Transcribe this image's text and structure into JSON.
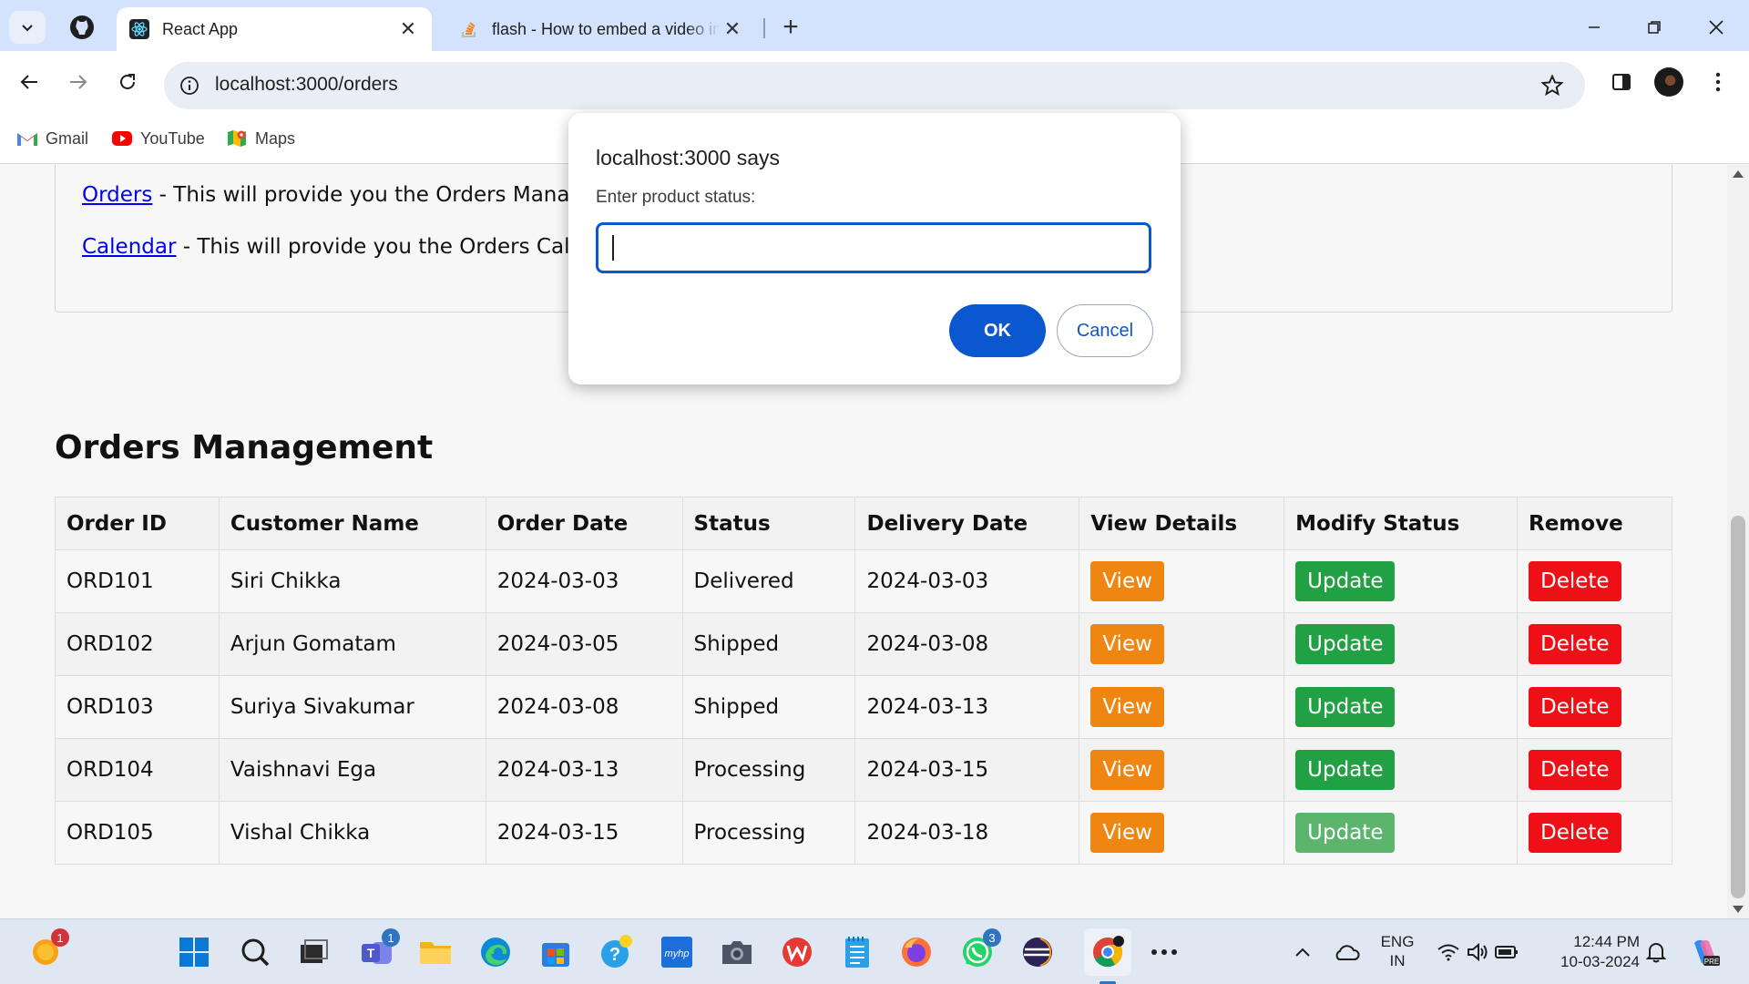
{
  "browser": {
    "tabs": [
      {
        "title": "React App",
        "active": true
      },
      {
        "title": "flash - How to embed a video in",
        "active": false
      }
    ],
    "url": "localhost:3000/orders",
    "bookmarks": [
      "Gmail",
      "YouTube",
      "Maps"
    ]
  },
  "page": {
    "links": [
      {
        "label": "Orders",
        "text": " - This will provide you the Orders Mana"
      },
      {
        "label": "Calendar",
        "text": " - This will provide you the Orders Cale"
      }
    ],
    "heading": "Orders Management",
    "table": {
      "headers": [
        "Order ID",
        "Customer Name",
        "Order Date",
        "Status",
        "Delivery Date",
        "View Details",
        "Modify Status",
        "Remove"
      ],
      "rows": [
        {
          "id": "ORD101",
          "customer": "Siri Chikka",
          "order_date": "2024-03-03",
          "status": "Delivered",
          "delivery_date": "2024-03-03"
        },
        {
          "id": "ORD102",
          "customer": "Arjun Gomatam",
          "order_date": "2024-03-05",
          "status": "Shipped",
          "delivery_date": "2024-03-08"
        },
        {
          "id": "ORD103",
          "customer": "Suriya Sivakumar",
          "order_date": "2024-03-08",
          "status": "Shipped",
          "delivery_date": "2024-03-13"
        },
        {
          "id": "ORD104",
          "customer": "Vaishnavi Ega",
          "order_date": "2024-03-13",
          "status": "Processing",
          "delivery_date": "2024-03-15"
        },
        {
          "id": "ORD105",
          "customer": "Vishal Chikka",
          "order_date": "2024-03-15",
          "status": "Processing",
          "delivery_date": "2024-03-18"
        }
      ],
      "view_label": "View",
      "update_label": "Update",
      "delete_label": "Delete"
    }
  },
  "dialog": {
    "title": "localhost:3000 says",
    "message": "Enter product status:",
    "input_value": "",
    "ok_label": "OK",
    "cancel_label": "Cancel"
  },
  "taskbar": {
    "badges": {
      "notification": "1",
      "teams": "1",
      "whatsapp": "3"
    },
    "language": "ENG",
    "region": "IN",
    "time": "12:44 PM",
    "date": "10-03-2024"
  },
  "colors": {
    "view": "#ee8611",
    "update": "#21a143",
    "delete": "#ee0f17",
    "accent": "#0b57d0",
    "link": "#0000ee"
  }
}
